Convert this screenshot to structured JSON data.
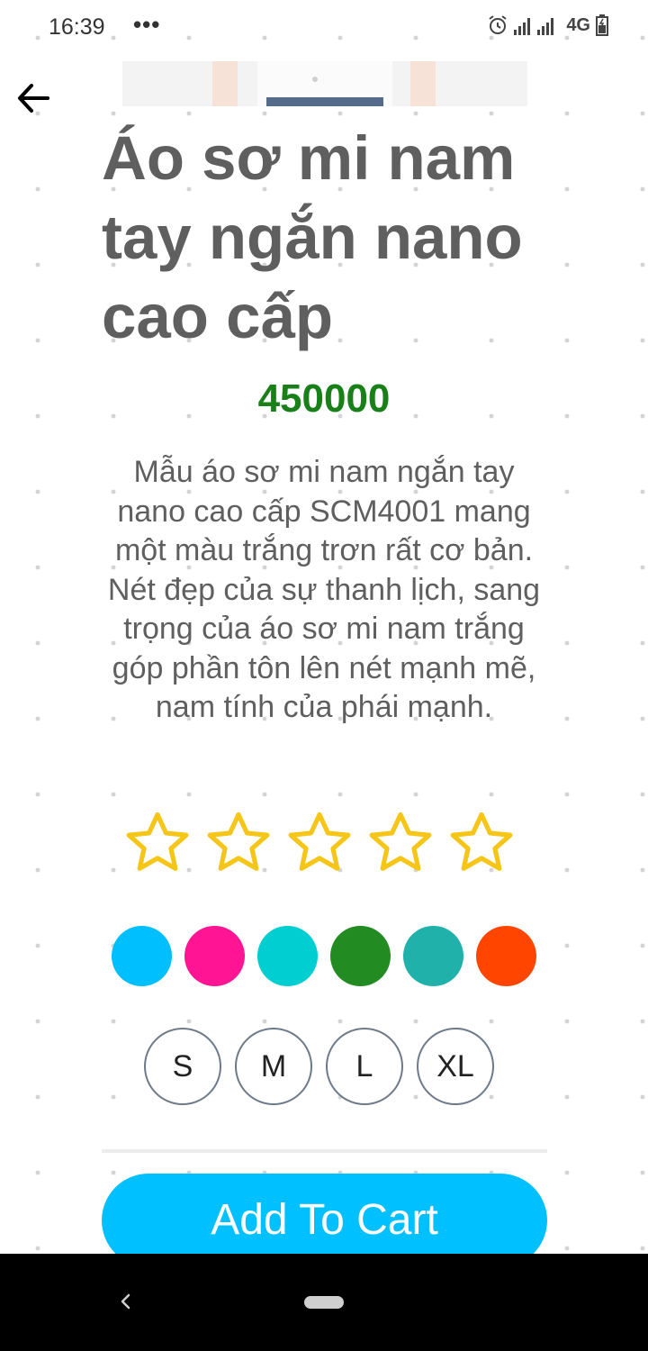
{
  "status_bar": {
    "time": "16:39",
    "dots": "•••",
    "network": "4G"
  },
  "product": {
    "title": "Áo sơ mi nam tay ngắn nano cao cấp",
    "price": "450000",
    "description": "Mẫu áo sơ mi nam ngắn tay nano cao cấp SCM4001 mang một màu trắng trơn rất cơ bản. Nét đẹp của sự thanh lịch, sang trọng của áo sơ mi nam trắng góp phần tôn lên nét mạnh mẽ, nam tính của phái mạnh.",
    "rating": {
      "max": 5,
      "value": 0,
      "star_color": "#f5c518"
    },
    "colors": [
      "#00bfff",
      "#ff1493",
      "#00ced1",
      "#228b22",
      "#20b2aa",
      "#ff4500"
    ],
    "sizes": [
      "S",
      "M",
      "L",
      "XL"
    ]
  },
  "actions": {
    "add_to_cart": "Add To Cart",
    "button_color": "#00c0ff"
  },
  "icons": {
    "back": "arrow-left-icon",
    "alarm": "alarm-icon",
    "signal": "signal-icon",
    "battery": "battery-icon"
  }
}
